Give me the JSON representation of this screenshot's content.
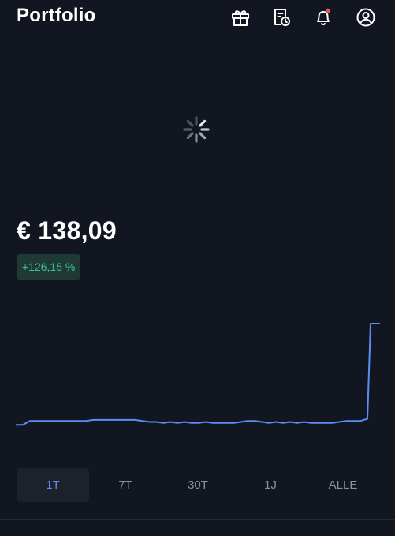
{
  "header": {
    "title": "Portfolio",
    "icons": [
      "gift-icon",
      "receipt-clock-icon",
      "bell-icon",
      "user-icon"
    ],
    "notification_dot_color": "#e05260"
  },
  "portfolio": {
    "value": "€ 138,09",
    "change": "+126,15 %",
    "change_color": "#3fbf8a"
  },
  "chart_data": {
    "type": "line",
    "line_color": "#5b8ef5",
    "grid": false,
    "series": [
      {
        "values": [
          10,
          10,
          12,
          12,
          12,
          12,
          12,
          12,
          12,
          12,
          12,
          12.5,
          12.5,
          12.5,
          12.5,
          12.5,
          12.5,
          12.5,
          12,
          11.5,
          11.5,
          11,
          11.5,
          11,
          11.5,
          11,
          11,
          11.5,
          11,
          11,
          11,
          11,
          11.5,
          12,
          12,
          11.5,
          11,
          11.5,
          11,
          11.5,
          11,
          11.5,
          11,
          11,
          11,
          11,
          11.5,
          12,
          12,
          12,
          13,
          60,
          60
        ]
      }
    ]
  },
  "ranges": {
    "items": [
      {
        "label": "1T",
        "active": true
      },
      {
        "label": "7T",
        "active": false
      },
      {
        "label": "30T",
        "active": false
      },
      {
        "label": "1J",
        "active": false
      },
      {
        "label": "ALLE",
        "active": false
      }
    ]
  },
  "colors": {
    "background": "#121620",
    "accent": "#5b8ef5"
  }
}
